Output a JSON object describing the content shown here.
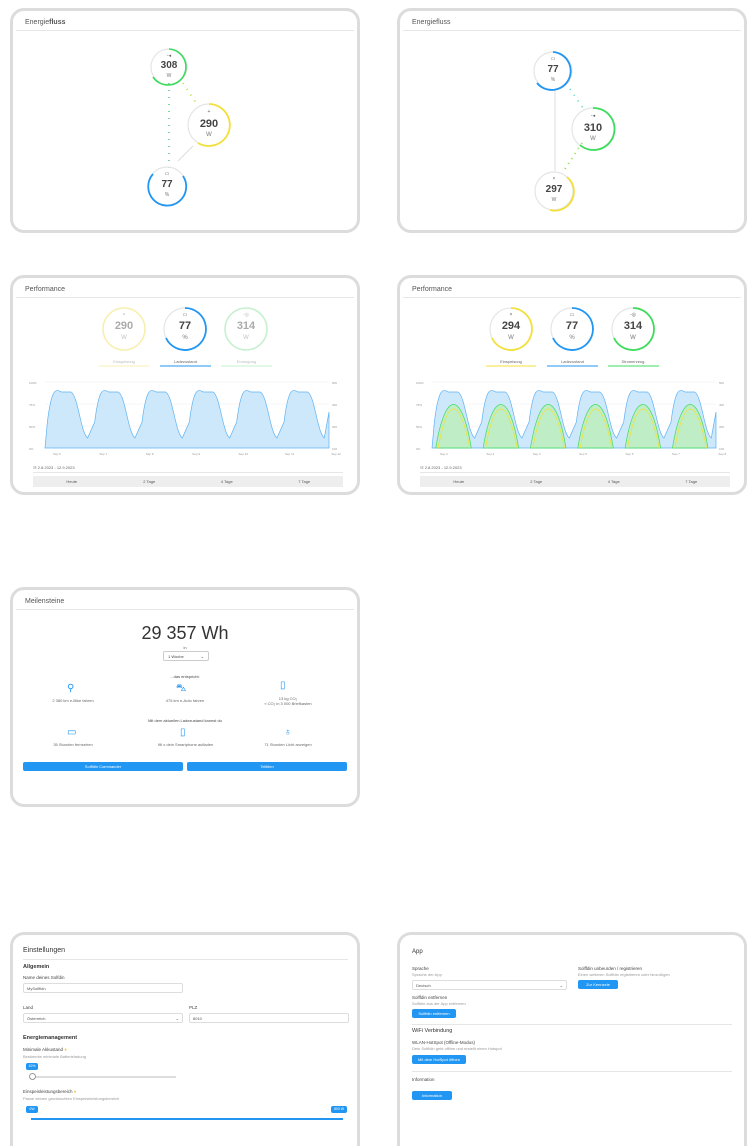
{
  "energy_left": {
    "title_prefix": "Energie",
    "title_bold": "fluss",
    "solar": {
      "value": "308",
      "unit": "W"
    },
    "grid": {
      "value": "290",
      "unit": "W",
      "icon": "+"
    },
    "battery": {
      "value": "77",
      "unit": "%"
    }
  },
  "energy_right": {
    "title": "Energiefluss",
    "battery": {
      "value": "77",
      "unit": "%"
    },
    "solar": {
      "value": "310",
      "unit": "W"
    },
    "grid": {
      "value": "297",
      "unit": "W",
      "icon": "×"
    }
  },
  "perf_left": {
    "title": "Performance",
    "rings": [
      {
        "value": "290",
        "unit": "W",
        "label": "Einspeisung",
        "icon": "×"
      },
      {
        "value": "77",
        "unit": "%",
        "label": "Ladezustand",
        "icon": "▭"
      },
      {
        "value": "314",
        "unit": "W",
        "label": "Erzeugung",
        "icon": "-◎"
      }
    ],
    "yleft": [
      "100%",
      "75%",
      "50%",
      "0%"
    ],
    "yright": [
      "500",
      "400",
      "300",
      "100"
    ],
    "xticks": [
      "Sep 6",
      "Sep 7",
      "Sep 8",
      "Sep 9",
      "Sep 10",
      "Sep 11",
      "Sep 12"
    ],
    "range": "2.8.2023 - 12.9.2023",
    "tabs": [
      "Heute",
      "2 Tage",
      "4 Tage",
      "7 Tage"
    ]
  },
  "perf_right": {
    "title": "Performance",
    "rings": [
      {
        "value": "294",
        "unit": "W",
        "label": "Einspeisung",
        "icon": "×"
      },
      {
        "value": "77",
        "unit": "%",
        "label": "Ladezustand",
        "icon": "▭"
      },
      {
        "value": "314",
        "unit": "W",
        "label": "Stromerzeug.",
        "icon": "-◎"
      }
    ],
    "yleft": [
      "100%",
      "75%",
      "50%",
      "0%"
    ],
    "yright": [
      "500",
      "400",
      "300",
      "100"
    ],
    "xticks": [
      "Sep 2",
      "Sep 3",
      "Sep 4",
      "Sep 5",
      "Sep 6",
      "Sep 7",
      "Sep 8"
    ],
    "range": "2.8.2023 - 12.9.2023",
    "tabs": [
      "Heute",
      "2 Tage",
      "4 Tage",
      "7 Tage"
    ]
  },
  "milestones": {
    "title": "Meilensteine",
    "total": "29 357 Wh",
    "in": "in",
    "period": "1 Woche",
    "saved_label": "...das entspricht:",
    "items1": [
      "2 380 km e-Bike fahren",
      "475 km e-Auto fahren",
      "13 kg CO₂\n≈ CO₂ in 3 000 Briefkasten"
    ],
    "charge_label": "Mit dem aktuellen Ladezustand kannst du",
    "items2": [
      "35 Stunden fernsehen",
      "96 x dein Smartphone aufladen",
      "71 Stunden Licht anzeigen"
    ],
    "btn1": "Solffdin Commander",
    "btn2": "Teiltilen"
  },
  "settings": {
    "title": "Einstellungen",
    "general": "Allgemein",
    "name_label": "Name deines Solfdin",
    "name_value": "MySolffidn",
    "land_label": "Land",
    "land_value": "Österreich",
    "plz_label": "PLZ",
    "plz_value": "8010",
    "energy_header": "Energiemanagement",
    "min_label": "Minimale Akkustand",
    "min_desc": "Bestimmte minimale Batterieladung",
    "min_val": "10%",
    "range_label": "Einspeisleistungsbereich",
    "range_desc": "Passe deinen gewünschten Einspeiseleistungsbereich",
    "range_min": "0W",
    "range_max": "800 W"
  },
  "app": {
    "title": "App",
    "lang_label": "Sprache",
    "lang_desc": "Sprache der App",
    "lang_value": "Deutsch",
    "register_label": "Solffdin unbeurden / registrieren",
    "register_desc": "Einen weiteren Solffdin registrieren oder hinzufügen",
    "register_btn": "Zur Kennzeie",
    "remove_label": "Solffdin entfernen",
    "remove_desc": "Solffdin aus der App entfernen",
    "remove_btn": "Solffdin entfernen",
    "wifi_header": "WiFi Verbindung",
    "hotspot_label": "WLAN-HotSpot (Offline-Modus)",
    "hotspot_desc": "Dein Solffdin geht offline und erstellt einen Hotspot",
    "hotspot_btn": "Mit dem HotSpot öffnen",
    "info_header": "Information",
    "info_btn": "Information"
  },
  "colors": {
    "blue": "#2196f3",
    "green": "#3ddc5c",
    "yellow": "#f3df3a",
    "light_blue": "#b8dcf7"
  }
}
